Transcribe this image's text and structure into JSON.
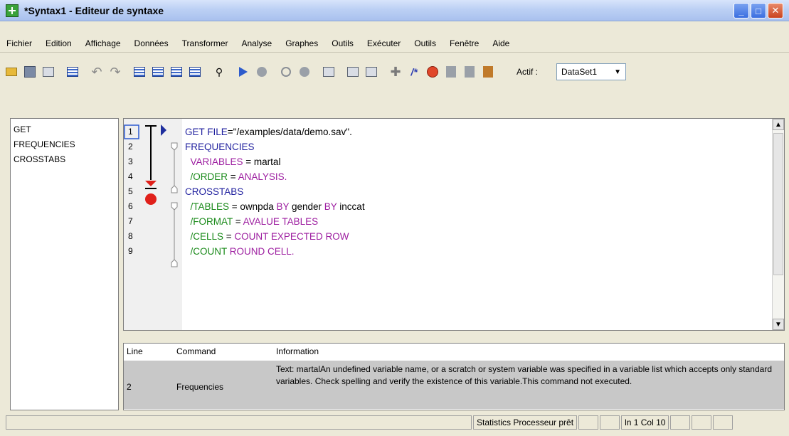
{
  "window": {
    "title": "*Syntax1 - Editeur de syntaxe",
    "minimize": "_",
    "maximize": "□",
    "close": "✕"
  },
  "menu": [
    "Fichier",
    "Edition",
    "Affichage",
    "Données",
    "Transformer",
    "Analyse",
    "Graphes",
    "Outils",
    "Exécuter",
    "Outils",
    "Fenêtre",
    "Aide"
  ],
  "toolbar": {
    "actif_label": "Actif :",
    "dataset_value": "DataSet1",
    "icons": [
      "open-icon",
      "save-icon",
      "print-icon",
      "dialog-recall-icon",
      "undo-icon",
      "redo-icon",
      "data-grid-icon",
      "goto-case-icon",
      "goto-variable-icon",
      "variables-icon",
      "find-icon",
      "run-icon",
      "stop-icon",
      "toggle-breakpoint-icon",
      "clear-breakpoints-icon",
      "syntax-help-icon",
      "output-icon",
      "use-sets-icon",
      "insert-icon",
      "comment-icon",
      "validate-icon",
      "bookmark-icon",
      "bookmark-prev-icon",
      "bookmark-next-icon"
    ]
  },
  "nav": [
    "GET",
    "FREQUENCIES",
    "CROSSTABS"
  ],
  "editor": {
    "line_numbers": [
      "1",
      "2",
      "3",
      "4",
      "5",
      "6",
      "7",
      "8",
      "9"
    ],
    "lines": [
      [
        {
          "t": "GET FILE",
          "c": "kw-blue"
        },
        {
          "t": "=\"/examples/data/demo.sav\".",
          "c": "txt"
        }
      ],
      [
        {
          "t": "FREQUENCIES",
          "c": "kw-blue"
        }
      ],
      [
        {
          "t": "  VARIABLES",
          "c": "kw-purple"
        },
        {
          "t": " = martal",
          "c": "txt"
        }
      ],
      [
        {
          "t": "  /ORDER",
          "c": "kw-green"
        },
        {
          "t": " = ",
          "c": "txt"
        },
        {
          "t": "ANALYSIS.",
          "c": "kw-purple"
        }
      ],
      [
        {
          "t": "CROSSTABS",
          "c": "kw-blue"
        }
      ],
      [
        {
          "t": "  /TABLES",
          "c": "kw-green"
        },
        {
          "t": " = ownpda ",
          "c": "txt"
        },
        {
          "t": "BY",
          "c": "kw-purple"
        },
        {
          "t": " gender ",
          "c": "txt"
        },
        {
          "t": "BY",
          "c": "kw-purple"
        },
        {
          "t": " inccat",
          "c": "txt"
        }
      ],
      [
        {
          "t": "  /FORMAT",
          "c": "kw-green"
        },
        {
          "t": " = ",
          "c": "txt"
        },
        {
          "t": "AVALUE TABLES",
          "c": "kw-purple"
        }
      ],
      [
        {
          "t": "  /CELLS",
          "c": "kw-green"
        },
        {
          "t": " = ",
          "c": "txt"
        },
        {
          "t": "COUNT EXPECTED ROW",
          "c": "kw-purple"
        }
      ],
      [
        {
          "t": "  /COUNT",
          "c": "kw-green"
        },
        {
          "t": " ",
          "c": "txt"
        },
        {
          "t": "ROUND CELL.",
          "c": "kw-purple"
        }
      ]
    ]
  },
  "errors": {
    "headers": [
      "Line",
      "Command",
      "Information"
    ],
    "rows": [
      {
        "line": "2",
        "command": "Frequencies",
        "information": "Text: martalAn undefined variable name, or a scratch or system variable was specified in a variable list which accepts only standard variables.  Check spelling and verify the existence of this variable.This command not executed."
      }
    ]
  },
  "status": {
    "processor": "Statistics  Processeur prêt",
    "position": "ln 1 Col 10"
  }
}
